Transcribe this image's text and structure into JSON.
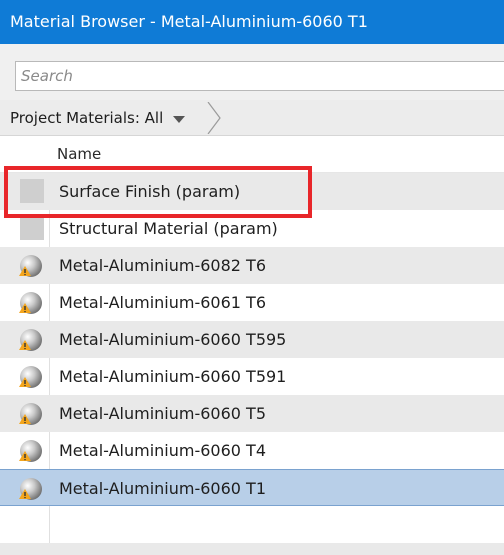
{
  "window": {
    "title": "Material Browser - Metal-Aluminium-6060 T1"
  },
  "search": {
    "placeholder": "Search"
  },
  "filter": {
    "label": "Project Materials: All"
  },
  "list": {
    "column_header": "Name",
    "items": [
      {
        "label": "Surface Finish (param)",
        "icon": "grey-swatch-icon",
        "highlighted": true
      },
      {
        "label": "Structural Material (param)",
        "icon": "grey-swatch-icon"
      },
      {
        "label": "Metal-Aluminium-6082 T6",
        "icon": "metal-sphere-warning-icon"
      },
      {
        "label": "Metal-Aluminium-6061 T6",
        "icon": "metal-sphere-warning-icon"
      },
      {
        "label": "Metal-Aluminium-6060 T595",
        "icon": "metal-sphere-warning-icon"
      },
      {
        "label": "Metal-Aluminium-6060 T591",
        "icon": "metal-sphere-warning-icon"
      },
      {
        "label": "Metal-Aluminium-6060 T5",
        "icon": "metal-sphere-warning-icon"
      },
      {
        "label": "Metal-Aluminium-6060 T4",
        "icon": "metal-sphere-warning-icon"
      },
      {
        "label": "Metal-Aluminium-6060 T1",
        "icon": "metal-sphere-warning-icon",
        "selected": true
      }
    ]
  },
  "colors": {
    "title_bar": "#0f7bd6",
    "selection": "#b8cfe8",
    "highlight_box": "#e8262a",
    "warning": "#f4a51c"
  }
}
